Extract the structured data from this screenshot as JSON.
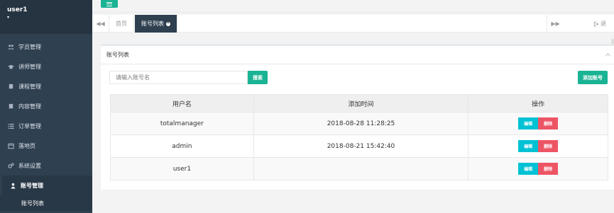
{
  "profile": {
    "name": "user1",
    "caret": "▾"
  },
  "nav": [
    {
      "label": "学员管理",
      "icon": "users-icon"
    },
    {
      "label": "讲师管理",
      "icon": "graduation-cap-icon"
    },
    {
      "label": "课程管理",
      "icon": "book-icon"
    },
    {
      "label": "内容管理",
      "icon": "book-icon"
    },
    {
      "label": "订单管理",
      "icon": "list-icon"
    },
    {
      "label": "落地页",
      "icon": "window-icon"
    },
    {
      "label": "系统设置",
      "icon": "cogs-icon"
    },
    {
      "label": "账号管理",
      "icon": "user-icon"
    }
  ],
  "nav_sub": {
    "label": "账号列表"
  },
  "tabs": {
    "home": "首页",
    "current": "账号列表",
    "exit": "退"
  },
  "panel": {
    "title": "账号列表",
    "search_placeholder": "请输入账号名",
    "search_label": "搜索",
    "add_label": "添加账号"
  },
  "table": {
    "headers": [
      "用户名",
      "添加时间",
      "操作"
    ],
    "rows": [
      {
        "username": "totalmanager",
        "time": "2018-08-28 11:28:25"
      },
      {
        "username": "admin",
        "time": "2018-08-21 15:42:40"
      },
      {
        "username": "user1",
        "time": ""
      }
    ],
    "edit_label": "编辑",
    "delete_label": "删除"
  },
  "colors": {
    "sidebar": "#2f4050",
    "accent": "#1ab394",
    "edit": "#00c2d4",
    "delete": "#ed5565"
  }
}
